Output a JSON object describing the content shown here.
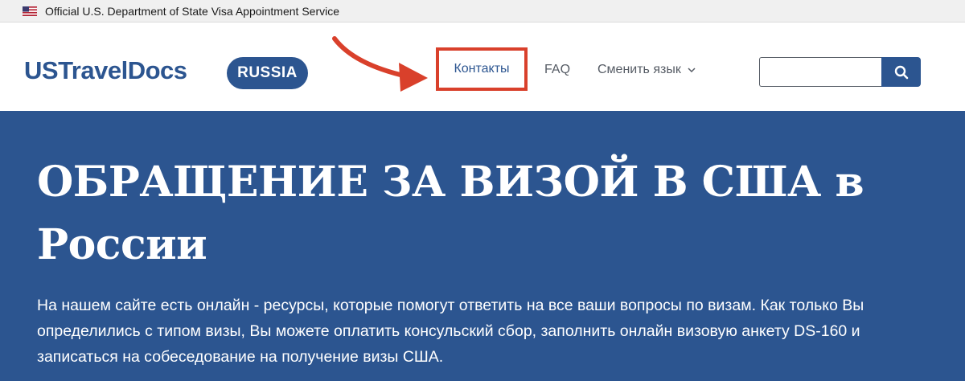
{
  "gov_banner": {
    "text": "Official U.S. Department of State Visa Appointment Service"
  },
  "header": {
    "logo": "USTravelDocs",
    "country_badge": "RUSSIA",
    "nav": {
      "contacts": "Контакты",
      "faq": "FAQ",
      "language": "Сменить язык"
    },
    "search": {
      "value": "",
      "placeholder": ""
    }
  },
  "hero": {
    "title": "ОБРАЩЕНИЕ ЗА ВИЗОЙ В США в России",
    "text": "На нашем сайте есть онлайн - ресурсы, которые помогут ответить на все ваши вопросы по визам. Как только Вы определились с типом визы, Вы можете оплатить консульский сбор, заполнить онлайн визовую анкету DS-160 и записаться на собеседование на получение визы США."
  },
  "icons": {
    "flag": "us-flag-icon",
    "search": "search-icon",
    "language_chevron": "chevron-down-icon",
    "annotation_arrow": "arrow-icon"
  },
  "colors": {
    "brand_blue": "#2c5590",
    "highlight_red": "#d9402b",
    "banner_gray": "#f0f0f0",
    "nav_gray": "#565c65"
  }
}
